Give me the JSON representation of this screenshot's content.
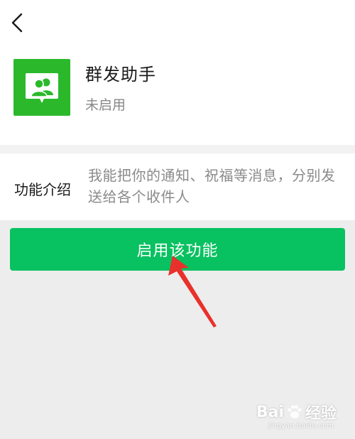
{
  "header": {
    "back_icon": "chevron-left-icon"
  },
  "app": {
    "name": "群发助手",
    "status": "未启用",
    "icon": "group-chat-icon",
    "icon_color": "#2bb92b"
  },
  "intro": {
    "label": "功能介绍",
    "text": "我能把你的通知、祝福等消息，分别发送给各个收件人"
  },
  "action": {
    "enable_label": "启用该功能",
    "color": "#08c160"
  },
  "annotation": {
    "arrow_color": "#e8312a"
  },
  "watermark": {
    "brand_left": "Bai",
    "brand_right": "经验",
    "url": "jingyan.baidu.com"
  }
}
